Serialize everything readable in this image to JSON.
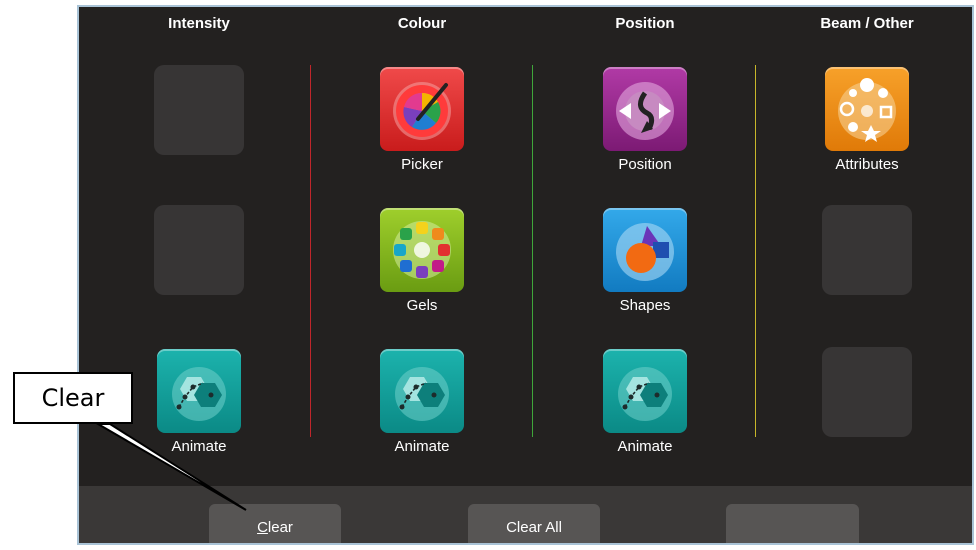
{
  "columns": [
    {
      "title": "Intensity"
    },
    {
      "title": "Colour"
    },
    {
      "title": "Position"
    },
    {
      "title": "Beam / Other"
    }
  ],
  "tiles": {
    "picker": "Picker",
    "position": "Position",
    "attributes": "Attributes",
    "gels": "Gels",
    "shapes": "Shapes",
    "animate": "Animate"
  },
  "footer": {
    "clear_prefix": "C",
    "clear_rest": "lear",
    "clear_all": "Clear All"
  },
  "callout": {
    "text": "Clear"
  },
  "colors": {
    "background": "#232120",
    "colour_divider": "#c0262b",
    "position_divider": "#3fa63a",
    "beam_divider": "#c7b62a"
  }
}
